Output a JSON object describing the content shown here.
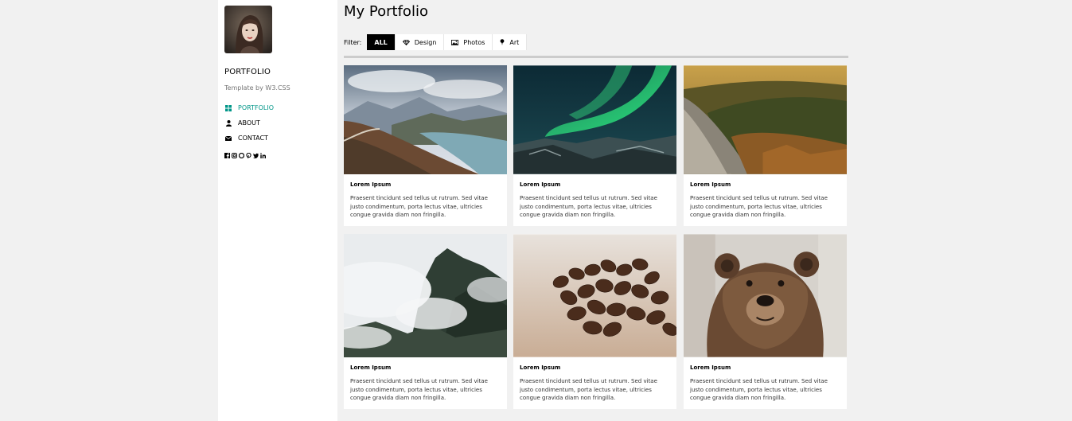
{
  "sidebar": {
    "brand": "PORTFOLIO",
    "tagline": "Template by W3.CSS",
    "nav": [
      {
        "label": "PORTFOLIO",
        "icon": "grid-icon",
        "active": true
      },
      {
        "label": "ABOUT",
        "icon": "user-icon",
        "active": false
      },
      {
        "label": "CONTACT",
        "icon": "envelope-icon",
        "active": false
      }
    ],
    "social_icons": [
      "facebook-icon",
      "instagram-icon",
      "snapchat-icon",
      "pinterest-icon",
      "twitter-icon",
      "linkedin-icon"
    ]
  },
  "main": {
    "title": "My Portfolio",
    "filter_label": "Filter:",
    "filters": [
      {
        "label": "ALL",
        "icon": "",
        "active": true
      },
      {
        "label": "Design",
        "icon": "diamond-icon",
        "active": false
      },
      {
        "label": "Photos",
        "icon": "photo-icon",
        "active": false
      },
      {
        "label": "Art",
        "icon": "map-marker-icon",
        "active": false
      }
    ],
    "cards": [
      {
        "title": "Lorem Ipsum",
        "text": "Praesent tincidunt sed tellus ut rutrum. Sed vitae justo condimentum, porta lectus vitae, ultricies congue gravida diam non fringilla.",
        "image": "mountain-lake-photo"
      },
      {
        "title": "Lorem Ipsum",
        "text": "Praesent tincidunt sed tellus ut rutrum. Sed vitae justo condimentum, porta lectus vitae, ultricies congue gravida diam non fringilla.",
        "image": "northern-lights-photo"
      },
      {
        "title": "Lorem Ipsum",
        "text": "Praesent tincidunt sed tellus ut rutrum. Sed vitae justo condimentum, porta lectus vitae, ultricies congue gravida diam non fringilla.",
        "image": "forest-valley-photo"
      },
      {
        "title": "Lorem Ipsum",
        "text": "Praesent tincidunt sed tellus ut rutrum. Sed vitae justo condimentum, porta lectus vitae, ultricies congue gravida diam non fringilla.",
        "image": "misty-mountain-photo"
      },
      {
        "title": "Lorem Ipsum",
        "text": "Praesent tincidunt sed tellus ut rutrum. Sed vitae justo condimentum, porta lectus vitae, ultricies congue gravida diam non fringilla.",
        "image": "coffee-beans-photo"
      },
      {
        "title": "Lorem Ipsum",
        "text": "Praesent tincidunt sed tellus ut rutrum. Sed vitae justo condimentum, porta lectus vitae, ultricies congue gravida diam non fringilla.",
        "image": "bear-photo"
      }
    ]
  },
  "colors": {
    "accent": "#009688",
    "background": "#f1f1f1",
    "active_filter": "#000000"
  }
}
